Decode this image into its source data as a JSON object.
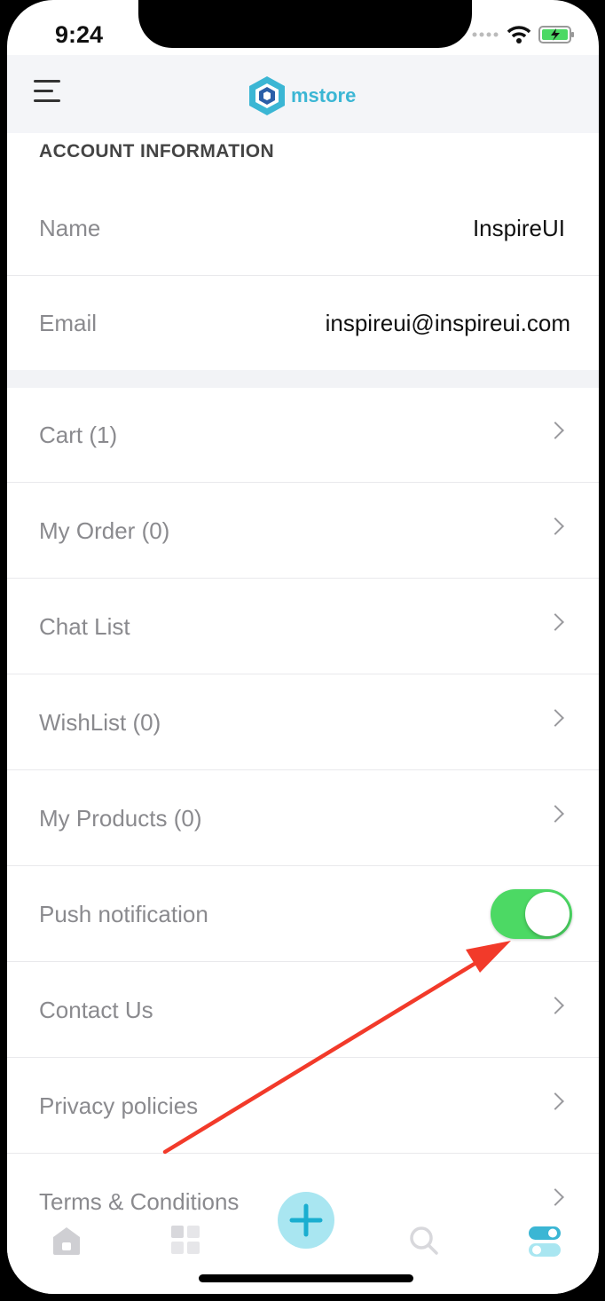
{
  "status": {
    "time": "9:24"
  },
  "header": {
    "logo_text": "mstore"
  },
  "account": {
    "section_title": "ACCOUNT INFORMATION",
    "name_label": "Name",
    "name_value": "InspireUI",
    "email_label": "Email",
    "email_value": "inspireui@inspireui.com"
  },
  "menu": {
    "items": [
      {
        "label": "Cart (1)"
      },
      {
        "label": "My Order (0)"
      },
      {
        "label": "Chat List"
      },
      {
        "label": "WishList (0)"
      },
      {
        "label": "My Products (0)"
      },
      {
        "label": "Push notification",
        "toggle_on": true
      },
      {
        "label": "Contact Us"
      },
      {
        "label": "Privacy policies"
      },
      {
        "label": "Terms & Conditions"
      }
    ]
  },
  "tabbar": {
    "tabs": [
      "home-icon",
      "grid-icon",
      "add-icon",
      "search-icon",
      "settings-toggle-icon"
    ],
    "active_tab": "settings-toggle-icon"
  },
  "colors": {
    "accent": "#3bb6d4",
    "toggle_on": "#4cd964",
    "annotation_arrow": "#f23a2a"
  }
}
